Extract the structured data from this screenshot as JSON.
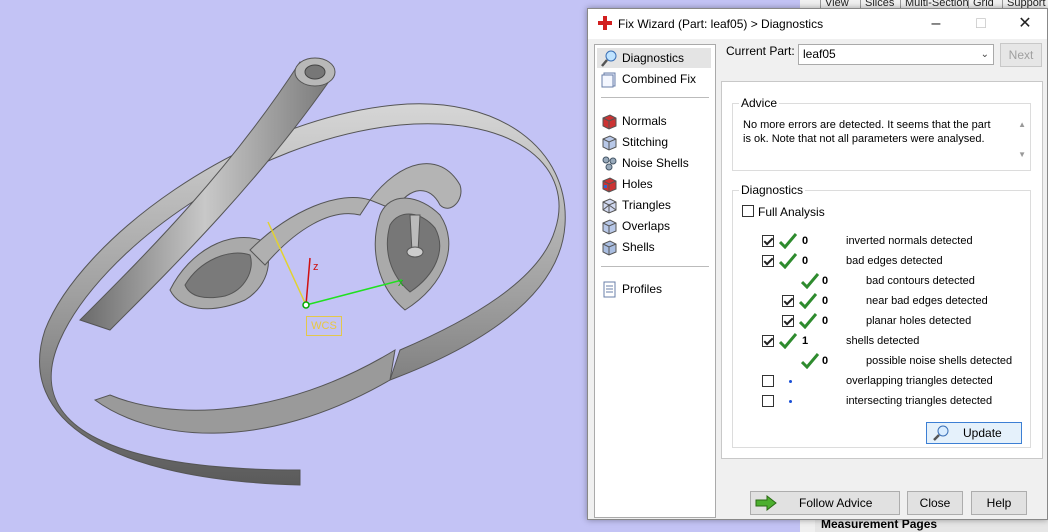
{
  "background": {
    "tabs": [
      "View",
      "Slices",
      "Multi-Section",
      "Grid",
      "Support V"
    ],
    "bottom_label": "Measurement Pages"
  },
  "viewport": {
    "axis_z": "z",
    "axis_x": "x",
    "wcs_label": "WCS"
  },
  "dialog": {
    "title": "Fix Wizard (Part: leaf05) > Diagnostics",
    "nav": {
      "items": [
        {
          "label": "Diagnostics",
          "icon": "diagnostics-icon",
          "selected": true
        },
        {
          "label": "Combined Fix",
          "icon": "combined-fix-icon"
        },
        {
          "label": "Normals",
          "icon": "normals-icon"
        },
        {
          "label": "Stitching",
          "icon": "stitching-icon"
        },
        {
          "label": "Noise Shells",
          "icon": "noise-shells-icon"
        },
        {
          "label": "Holes",
          "icon": "holes-icon"
        },
        {
          "label": "Triangles",
          "icon": "triangles-icon"
        },
        {
          "label": "Overlaps",
          "icon": "overlaps-icon"
        },
        {
          "label": "Shells",
          "icon": "shells-icon"
        },
        {
          "label": "Profiles",
          "icon": "profiles-icon"
        }
      ]
    },
    "current_part_label": "Current Part:",
    "current_part_value": "leaf05",
    "next_label": "Next",
    "advice": {
      "title": "Advice",
      "text": "No more errors are detected. It seems that the part is ok. Note that not all parameters were analysed."
    },
    "diagnostics": {
      "title": "Diagnostics",
      "full_analysis_label": "Full Analysis",
      "rows": [
        {
          "checked": true,
          "tick": true,
          "count": "0",
          "label": "inverted normals detected",
          "indent": 0
        },
        {
          "checked": true,
          "tick": true,
          "count": "0",
          "label": "bad edges detected",
          "indent": 0
        },
        {
          "checkbox": false,
          "tick": true,
          "count": "0",
          "label": "bad contours detected",
          "indent": 1
        },
        {
          "checked": true,
          "tick": true,
          "count": "0",
          "label": "near bad edges detected",
          "indent": 1
        },
        {
          "checked": true,
          "tick": true,
          "count": "0",
          "label": "planar holes detected",
          "indent": 1
        },
        {
          "checked": true,
          "tick": true,
          "count": "1",
          "label": "shells detected",
          "indent": 0
        },
        {
          "checkbox": false,
          "tick": true,
          "count": "0",
          "label": "possible noise shells detected",
          "indent": 1
        },
        {
          "checked": false,
          "tick": false,
          "count": "",
          "label": "overlapping triangles detected",
          "indent": 0
        },
        {
          "checked": false,
          "tick": false,
          "count": "",
          "label": "intersecting triangles detected",
          "indent": 0
        }
      ],
      "update_label": "Update"
    },
    "buttons": {
      "follow_advice": "Follow Advice",
      "close": "Close",
      "help": "Help"
    }
  }
}
